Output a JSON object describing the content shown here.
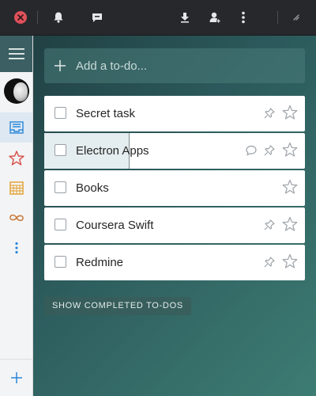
{
  "toolbar": {
    "icons": [
      "close-icon",
      "bell-icon",
      "comment-icon",
      "download-icon",
      "add-user-icon",
      "more-vertical-icon",
      "resize-icon"
    ]
  },
  "sidebar": {
    "items": [
      {
        "name": "menu",
        "icon": "hamburger-icon"
      },
      {
        "name": "avatar",
        "icon": "user-avatar"
      },
      {
        "name": "inbox",
        "icon": "inbox-icon",
        "active": true,
        "color": "#2b88d9"
      },
      {
        "name": "starred",
        "icon": "star-icon",
        "color": "#d74e48"
      },
      {
        "name": "week",
        "icon": "calendar-icon",
        "color": "#e39e2d"
      },
      {
        "name": "all",
        "icon": "infinity-icon",
        "color": "#c6793a"
      },
      {
        "name": "more",
        "icon": "more-vertical-icon",
        "color": "#2b88d9"
      }
    ],
    "add_icon": "plus-icon"
  },
  "add_todo": {
    "placeholder": "Add a to-do..."
  },
  "tasks": [
    {
      "title": "Secret task",
      "pinned": true,
      "comment": false,
      "starred": false
    },
    {
      "title": "Electron Apps",
      "pinned": true,
      "comment": true,
      "starred": false
    },
    {
      "title": "Books",
      "pinned": false,
      "comment": false,
      "starred": false
    },
    {
      "title": "Coursera Swift",
      "pinned": true,
      "comment": false,
      "starred": false
    },
    {
      "title": "Redmine",
      "pinned": true,
      "comment": false,
      "starred": false
    }
  ],
  "show_completed_label": "SHOW COMPLETED TO-DOS",
  "colors": {
    "close": "#e0505a",
    "accent_blue": "#2b88d9",
    "star_red": "#d74e48",
    "calendar_orange": "#e39e2d"
  }
}
